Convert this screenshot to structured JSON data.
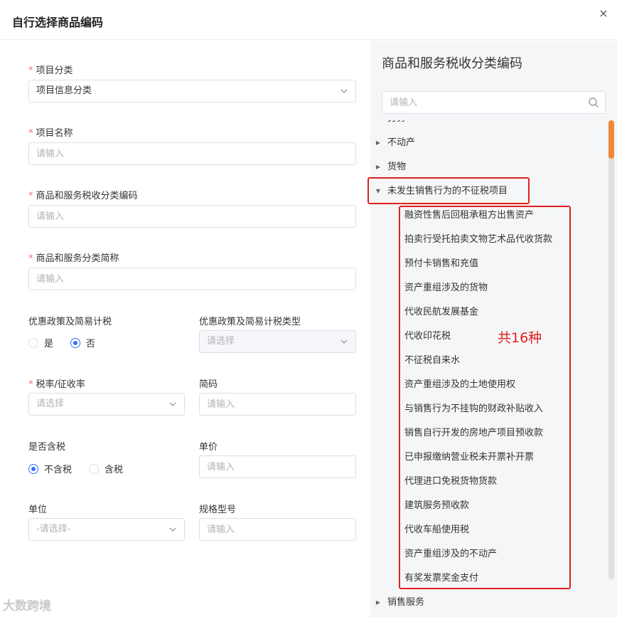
{
  "dialog": {
    "title": "自行选择商品编码",
    "close_glyph": "×"
  },
  "form": {
    "item_category": {
      "label": "项目分类",
      "required_mark": "*",
      "value": "项目信息分类"
    },
    "item_name": {
      "label": "项目名称",
      "required_mark": "*",
      "placeholder": "请输入"
    },
    "tax_code": {
      "label": "商品和服务税收分类编码",
      "required_mark": "*",
      "placeholder": "请输入"
    },
    "tax_short_name": {
      "label": "商品和服务分类简称",
      "required_mark": "*",
      "placeholder": "请输入"
    },
    "preferential_policy": {
      "label": "优惠政策及简易计税",
      "options": [
        "是",
        "否"
      ],
      "selected": "否"
    },
    "preferential_type": {
      "label": "优惠政策及简易计税类型",
      "placeholder": "请选择"
    },
    "tax_rate": {
      "label": "税率/征收率",
      "required_mark": "*",
      "placeholder": "请选择"
    },
    "short_code": {
      "label": "简码",
      "placeholder": "请输入"
    },
    "tax_included": {
      "label": "是否含税",
      "options": [
        "不含税",
        "含税"
      ],
      "selected": "不含税"
    },
    "unit_price": {
      "label": "单价",
      "placeholder": "请输入"
    },
    "unit": {
      "label": "单位",
      "placeholder": "-请选择-"
    },
    "spec_model": {
      "label": "规格型号",
      "placeholder": "请输入"
    }
  },
  "tree": {
    "title": "商品和服务税收分类编码",
    "search_placeholder": "请输入",
    "partial_top_label": "劳务",
    "nodes": [
      {
        "label": "不动产",
        "expanded": false
      },
      {
        "label": "货物",
        "expanded": false
      },
      {
        "label": "未发生销售行为的不征税项目",
        "expanded": true
      }
    ],
    "children": [
      "融资性售后回租承租方出售资产",
      "拍卖行受托拍卖文物艺术品代收货款",
      "预付卡销售和充值",
      "资产重组涉及的货物",
      "代收民航发展基金",
      "代收印花税",
      "不征税自来水",
      "资产重组涉及的土地使用权",
      "与销售行为不挂钩的财政补贴收入",
      "销售自行开发的房地产项目预收款",
      "已申报缴纳营业税未开票补开票",
      "代理进口免税货物货款",
      "建筑服务预收款",
      "代收车船使用税",
      "资产重组涉及的不动产",
      "有奖发票奖金支付"
    ],
    "bottom_node": {
      "label": "销售服务",
      "expanded": false
    }
  },
  "annotation": {
    "count_note": "共16种",
    "color": "#e02020"
  },
  "watermark": {
    "text": "大数跨境"
  },
  "colors": {
    "accent": "#3370ff",
    "required": "#f56c6c",
    "scroll_thumb": "#f0873e"
  }
}
